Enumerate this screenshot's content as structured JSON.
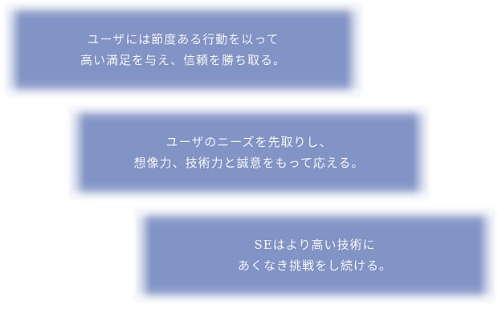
{
  "colors": {
    "card_fill": "#8294c6",
    "text": "#ffffff",
    "background": "#ffffff"
  },
  "cards": [
    {
      "lines": [
        "ユーザには節度ある行動を以って",
        "高い満足を与え、信頼を勝ち取る。"
      ]
    },
    {
      "lines": [
        "ユーザのニーズを先取りし、",
        "想像力、技術力と誠意をもって応える。"
      ]
    },
    {
      "lines": [
        "SEはより高い技術に",
        "あくなき挑戦をし続ける。"
      ]
    }
  ]
}
